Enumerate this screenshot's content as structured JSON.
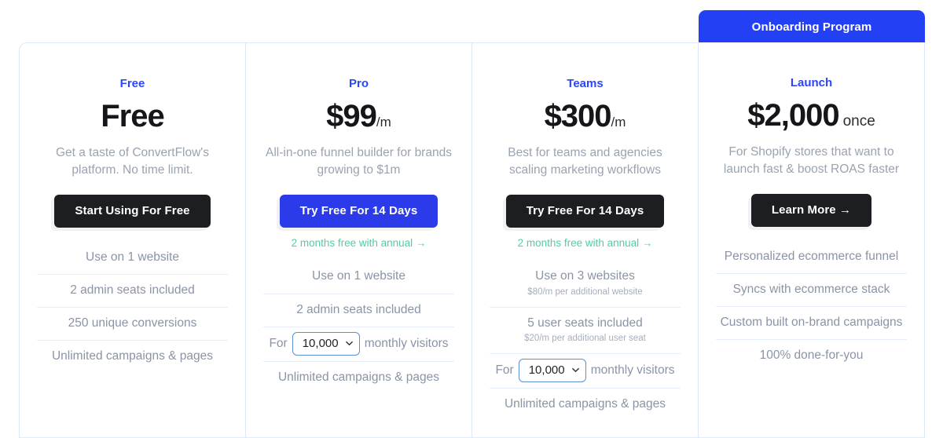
{
  "featured_banner": {
    "label": "Onboarding Program",
    "color": "#2440f5"
  },
  "colors": {
    "plan_name": "#2b45ff",
    "cta_dark": "#1d1e21",
    "cta_blue": "#2b3bea",
    "annual_note": "#4ecfa4",
    "feature_text": "#8a94a6",
    "card_border": "#dce9f7"
  },
  "plans": [
    {
      "name": "Free",
      "price": "Free",
      "price_suffix": "",
      "tagline": "Get a taste of ConvertFlow's platform. No time limit.",
      "cta_label": "Start Using For Free",
      "cta_style": "dark",
      "annual_note": "",
      "features": [
        {
          "main": "Use on 1 website",
          "sub": ""
        },
        {
          "main": "2 admin seats included",
          "sub": ""
        },
        {
          "main": "250 unique conversions",
          "sub": ""
        },
        {
          "main": "Unlimited campaigns & pages",
          "sub": ""
        }
      ]
    },
    {
      "name": "Pro",
      "price": "$99",
      "price_suffix": "/m",
      "tagline": "All-in-one funnel builder for brands growing to $1m",
      "cta_label": "Try Free For 14 Days",
      "cta_style": "blue",
      "annual_note": "2 months free with annual →",
      "features": [
        {
          "main": "Use on 1 website",
          "sub": ""
        },
        {
          "main": "2 admin seats included",
          "sub": ""
        },
        {
          "main": "",
          "sub": "",
          "select": {
            "prefix": "For",
            "value": "10,000",
            "suffix": "monthly visitors",
            "options": [
              "10,000"
            ]
          }
        },
        {
          "main": "Unlimited campaigns & pages",
          "sub": ""
        }
      ]
    },
    {
      "name": "Teams",
      "price": "$300",
      "price_suffix": "/m",
      "tagline": "Best for teams and agencies scaling marketing workflows",
      "cta_label": "Try Free For 14 Days",
      "cta_style": "dark",
      "annual_note": "2 months free with annual →",
      "features": [
        {
          "main": "Use on 3 websites",
          "sub": "$80/m per additional website"
        },
        {
          "main": "5 user seats included",
          "sub": "$20/m per additional user seat"
        },
        {
          "main": "",
          "sub": "",
          "select": {
            "prefix": "For",
            "value": "10,000",
            "suffix": "monthly visitors",
            "options": [
              "10,000"
            ]
          }
        },
        {
          "main": "Unlimited campaigns & pages",
          "sub": ""
        }
      ]
    },
    {
      "name": "Launch",
      "price": "$2,000",
      "price_suffix": "once",
      "tagline": "For Shopify stores that want to launch fast & boost ROAS faster",
      "cta_label": "Learn More →",
      "cta_style": "dark",
      "annual_note": "",
      "features": [
        {
          "main": "Personalized ecommerce funnel",
          "sub": ""
        },
        {
          "main": "Syncs with ecommerce stack",
          "sub": ""
        },
        {
          "main": "Custom built on-brand campaigns",
          "sub": ""
        },
        {
          "main": "100% done-for-you",
          "sub": ""
        }
      ]
    }
  ]
}
